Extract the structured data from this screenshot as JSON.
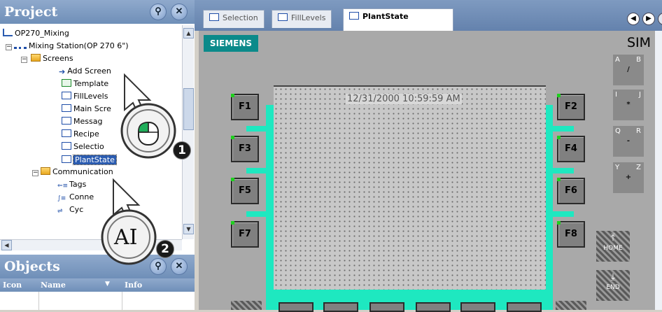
{
  "project_panel": {
    "title": "Project",
    "tree": {
      "root": "OP270_Mixing",
      "station": "Mixing Station(OP 270 6\")",
      "screens_folder": "Screens",
      "items": [
        "Add Screen",
        "Template",
        "FillLevels",
        "Main Scre",
        "Messag",
        "Recipe",
        "Selectio",
        "PlantState"
      ],
      "comm_folder": "Communication",
      "comm_items": [
        "Tags",
        "Conne",
        "Cyc"
      ]
    }
  },
  "objects_panel": {
    "title": "Objects",
    "columns": [
      "Icon",
      "Name",
      "Info"
    ]
  },
  "tabs": [
    {
      "label": "Selection",
      "active": false
    },
    {
      "label": "FillLevels",
      "active": false
    },
    {
      "label": "PlantState",
      "active": true
    }
  ],
  "device": {
    "brand": "SIEMENS",
    "sim_label": "SIM",
    "datetime": "12/31/2000 10:59:59 AM",
    "fkeys_left": [
      "F1",
      "F3",
      "F5",
      "F7"
    ],
    "fkeys_right": [
      "F2",
      "F4",
      "F6",
      "F8"
    ],
    "keypad": [
      {
        "a": "A",
        "b": "B",
        "c": "/"
      },
      {
        "a": "I",
        "b": "J",
        "c": "*"
      },
      {
        "a": "Q",
        "b": "R",
        "c": "-"
      },
      {
        "a": "Y",
        "b": "Z",
        "c": "+"
      }
    ],
    "home_label": "HOME",
    "end_label": "END"
  },
  "callouts": {
    "step1": "1",
    "step2": "2",
    "text_cursor_icon": "AI"
  },
  "colors": {
    "teal_frame": "#1ee8c0",
    "tab_bar": "#6f8fb8",
    "siemens_badge": "#0b8a8a"
  }
}
